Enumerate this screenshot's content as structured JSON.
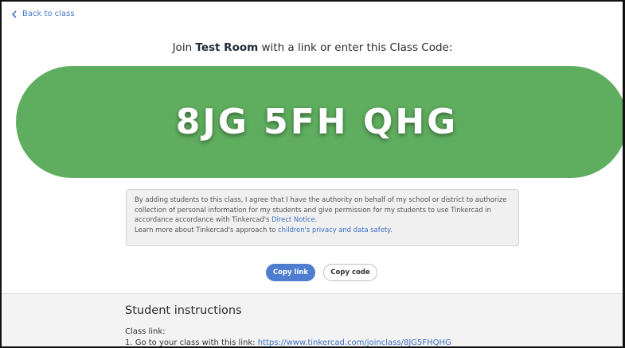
{
  "nav": {
    "back_label": "Back to class"
  },
  "header": {
    "prefix": "Join ",
    "room_name": "Test Room",
    "suffix": " with a link or enter this Class Code:"
  },
  "class_code": "8JG 5FH QHG",
  "notice": {
    "text_1": "By adding students to this class, I agree that I have the authority on behalf of my school or district to authorize collection of personal information for my students and give permission for my students to use Tinkercad in accordance accordance with Tinkercad's ",
    "link_1": "Direct Notice",
    "text_2": ".",
    "text_3": "Learn more about Tinkercad's approach to ",
    "link_2": "children's privacy and data safety",
    "text_4": "."
  },
  "buttons": {
    "copy_link": "Copy link",
    "copy_code": "Copy code"
  },
  "instructions": {
    "heading": "Student instructions",
    "class_link_label": "Class link:",
    "step_1_prefix": "1.  Go to your class with this link: ",
    "step_1_url": "https://www.tinkercad.com/joinclass/8JG5FHQHG"
  },
  "colors": {
    "code_background": "#5fae5f",
    "primary_button": "#4f7dd0",
    "link": "#3a6fc4"
  }
}
